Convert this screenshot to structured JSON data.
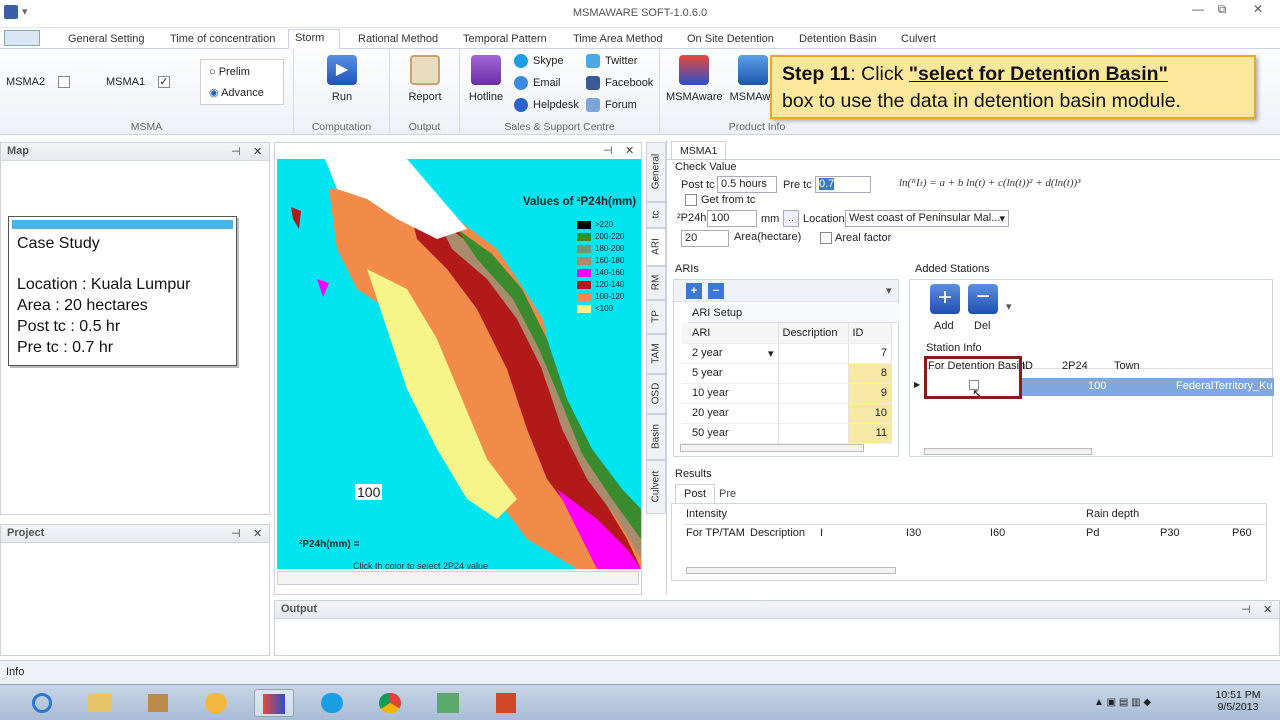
{
  "app": {
    "title": "MSMAWARE SOFT-1.0.6.0",
    "window_controls": [
      "—",
      "⧉",
      "✕"
    ]
  },
  "tabs": [
    "General Setting",
    "Time of concentration",
    "Storm",
    "Rational Method",
    "Temporal Pattern",
    "Time Area Method",
    "On Site Detention",
    "Detention Basin",
    "Culvert"
  ],
  "ribbon": {
    "msma": {
      "msma2": "MSMA2",
      "msma1": "MSMA1",
      "prelim": "Prelim",
      "advance": "Advance",
      "group": "MSMA"
    },
    "computation": {
      "run": "Run",
      "group": "Computation"
    },
    "output": {
      "report": "Report",
      "group": "Output"
    },
    "sales": {
      "hotline": "Hotline",
      "skype": "Skype",
      "email": "Email",
      "helpdesk": "Helpdesk",
      "twitter": "Twitter",
      "facebook": "Facebook",
      "forum": "Forum",
      "group": "Sales & Support Centre"
    },
    "product": {
      "msmaware": "MSMAware",
      "msmaware2": "MSMAwa",
      "group": "Product Info"
    }
  },
  "callout": {
    "step": "Step 11",
    "pre": ": Click ",
    "link": "\"select for Detention Basin\"",
    "post": "box to use the data in detention basin module."
  },
  "map_panel": {
    "title": "Map"
  },
  "project_panel": {
    "title": "Project"
  },
  "output_panel": {
    "title": "Output"
  },
  "status": {
    "text": "Info"
  },
  "case_study": {
    "title": "Case Study",
    "location": "Location   : Kuala Lumpur",
    "area": "Area        : 20 hectares",
    "post": "Post tc       : 0.5 hr",
    "pre": "Pre tc         : 0.7 hr"
  },
  "map_legend": {
    "title": "Values of ²P24h(mm)",
    "items": [
      ">220",
      "200-220",
      "180-200",
      "160-180",
      "140-160",
      "120-140",
      "100-120",
      "<100"
    ],
    "colors": [
      "#000000",
      "#3a8a2e",
      "#6b9a7a",
      "#a98c6e",
      "#ff00ff",
      "#b21a1a",
      "#f28a4a",
      "#f7f58a"
    ],
    "value_label": "100",
    "footer": "²P24h(mm) =",
    "click_text": "Click th color to select 2P24 value"
  },
  "side_tabs": [
    "General",
    "tc",
    "ARI",
    "RM",
    "TP",
    "TAM",
    "OSD",
    "Basin",
    "Culvert"
  ],
  "storm": {
    "doc_tab": "MSMA1",
    "check_value": "Check Value",
    "post_tc_label": "Post tc",
    "post_tc": "0.5 hours",
    "pre_tc_label": "Pre tc",
    "pre_tc": "0.7",
    "get_from_tc": "Get from tc",
    "p24_label": "²P24h",
    "p24_value": "100",
    "mm": "mm",
    "dots": "..",
    "location_label": "Location",
    "location_value": "West coast of Peninsular Mal...",
    "area_value": "20",
    "area_label": "Area(hectare)",
    "areal_factor": "Areal factor",
    "formula": "ln(ᴿIₜ) = a + b ln(t) + c(ln(t))² + d(ln(t))³"
  },
  "aris": {
    "title": "ARIs",
    "setup": "ARI Setup",
    "cols": [
      "ARI",
      "Description",
      "ID"
    ],
    "rows": [
      {
        "ari": "2 year",
        "id": "7"
      },
      {
        "ari": "5 year",
        "id": "8"
      },
      {
        "ari": "10 year",
        "id": "9"
      },
      {
        "ari": "20 year",
        "id": "10"
      },
      {
        "ari": "50 year",
        "id": "11"
      }
    ]
  },
  "stations": {
    "title": "Added Stations",
    "add": "Add",
    "del": "Del",
    "info": "Station Info",
    "cols": [
      "For Detention Basin",
      "ID",
      "2P24",
      "Town"
    ],
    "row": {
      "p24": "100",
      "town": "FederalTerritory_Kua"
    }
  },
  "results": {
    "title": "Results",
    "tabs": [
      "Post",
      "Pre"
    ],
    "group1": "Intensity",
    "group2": "Rain depth",
    "cols": [
      "For TP/TAM",
      "Description",
      "I",
      "I30",
      "I60",
      "Pd",
      "P30",
      "P60"
    ]
  },
  "taskbar": {
    "time": "10:51 PM",
    "date": "9/5/2013"
  }
}
